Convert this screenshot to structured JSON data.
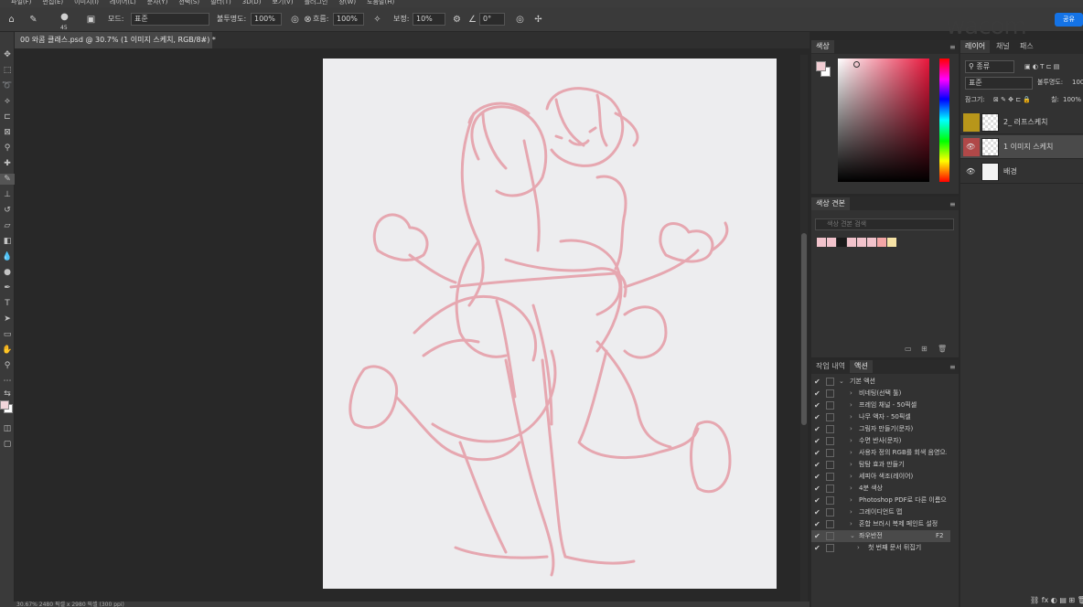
{
  "menu": [
    "파일(F)",
    "편집(E)",
    "이미지(I)",
    "레이어(L)",
    "문자(Y)",
    "선택(S)",
    "필터(T)",
    "3D(D)",
    "보기(V)",
    "플러그인",
    "창(W)",
    "도움말(H)"
  ],
  "options": {
    "brush_size": "45",
    "mode_label": "모드:",
    "mode_value": "표준",
    "opacity_label": "불투명도:",
    "opacity_value": "100%",
    "flow_label": "흐름:",
    "flow_value": "100%",
    "smoothing_label": "보정:",
    "smoothing_value": "10%",
    "angle_value": "0°"
  },
  "brand": "wacom",
  "share_label": "공유",
  "document": {
    "tab_title": "00 와콤 클래스.psd @ 30.7% (1 이미지 스케치, RGB/8#) *",
    "close": "×",
    "status": "30.67%    2480 픽셀 x 2980 픽셀 (300 ppi)"
  },
  "color_panel": {
    "tab": "색상"
  },
  "swatches_panel": {
    "tab": "색상 견본",
    "search_placeholder": "색상 견본 검색",
    "colors": [
      "#f2c3cc",
      "#f2c3cc",
      "#1a1a1a",
      "#f2c3cc",
      "#f2c3cc",
      "#f2c3cc",
      "#f4a6a6",
      "#f7e3a6"
    ]
  },
  "actions_panel": {
    "tabs": [
      "작업 내역",
      "액션"
    ],
    "rows": [
      {
        "label": "기본 액션",
        "folder": true
      },
      {
        "label": "비네팅(선택 툴)"
      },
      {
        "label": "프레임 채널 - 50픽셀"
      },
      {
        "label": "나무 액자 - 50픽셀"
      },
      {
        "label": "그림자 만들기(문자)"
      },
      {
        "label": "수면 반사(문자)"
      },
      {
        "label": "사용자 정의 RGB를 회색 음영으로"
      },
      {
        "label": "탐탐 효과 만들기"
      },
      {
        "label": "세피아 색조(레이어)"
      },
      {
        "label": "4분 색상"
      },
      {
        "label": "Photoshop PDF로 다른 이름으로 저장"
      },
      {
        "label": "그레이디언트 맵"
      },
      {
        "label": "혼합 브러시 복제 페인트 설정"
      },
      {
        "label": "좌우반전",
        "key": "F2",
        "selected": true
      },
      {
        "label": "첫 번째 문서 뒤집기",
        "sub": true
      }
    ]
  },
  "layers_panel": {
    "tabs": [
      "레이어",
      "채널",
      "패스"
    ],
    "filter_label": "종류",
    "blend_mode": "표준",
    "opacity_label": "불투명도:",
    "opacity_value": "100%",
    "lock_label": "잠그기:",
    "fill_label": "칠:",
    "fill_value": "100%",
    "layers": [
      {
        "name": "2_ 러프스케치",
        "tag_color": "#b8961a",
        "visible": false
      },
      {
        "name": "1 이미지 스케치",
        "tag_color": "#b04848",
        "visible": true,
        "selected": true
      },
      {
        "name": "배경",
        "tag_color": "",
        "visible": true
      }
    ]
  },
  "colors": {
    "accent": "#1473e6",
    "sketch": "#e6a7b0",
    "canvas": "#ededef"
  }
}
